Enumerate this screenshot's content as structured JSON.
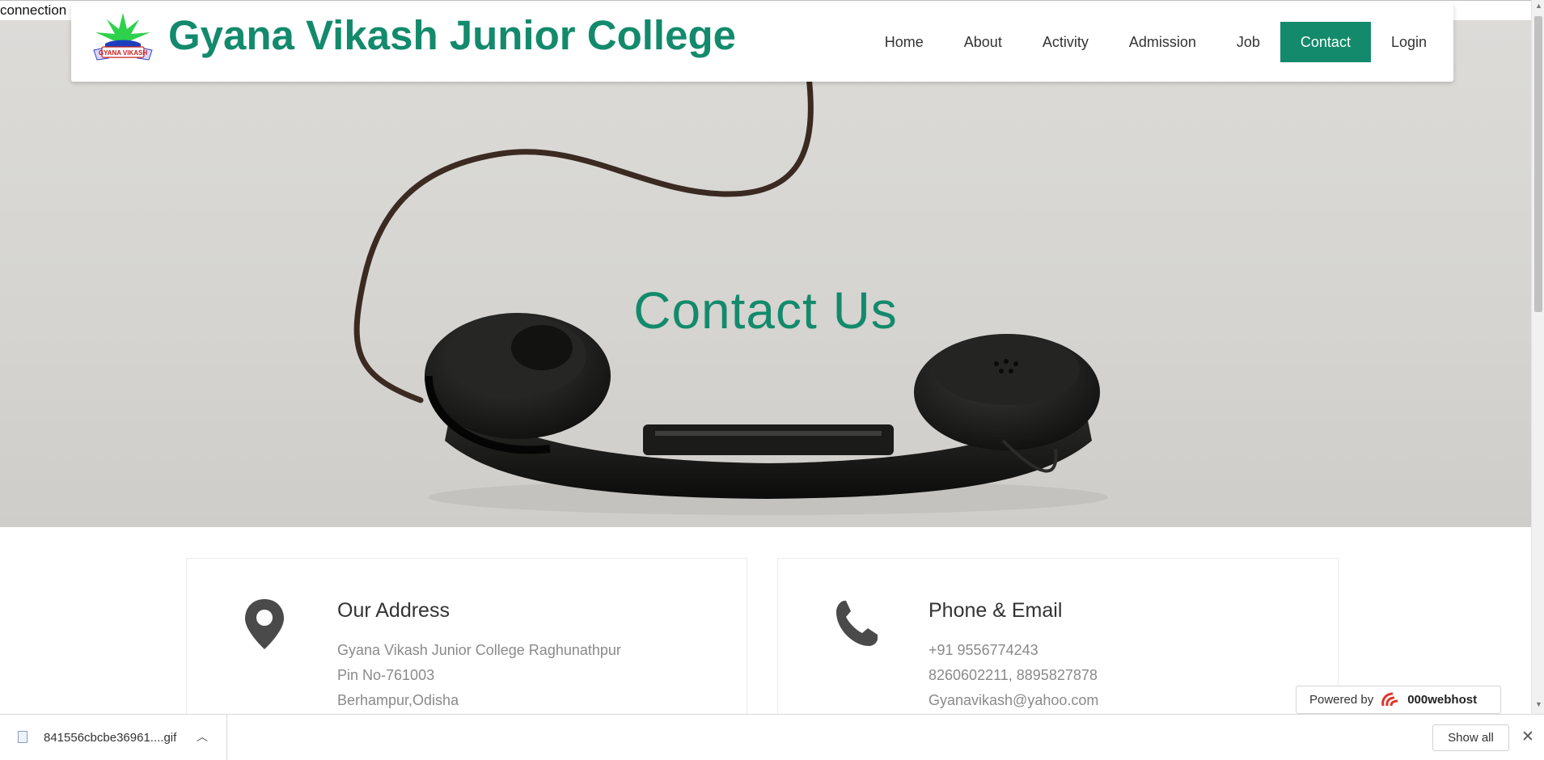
{
  "status_fragment": "connection",
  "header": {
    "title": "Gyana Vikash Junior College",
    "logo_text": "GYANA VIKASH",
    "nav": [
      {
        "label": "Home",
        "active": false
      },
      {
        "label": "About",
        "active": false
      },
      {
        "label": "Activity",
        "active": false
      },
      {
        "label": "Admission",
        "active": false
      },
      {
        "label": "Job",
        "active": false
      },
      {
        "label": "Contact",
        "active": true
      },
      {
        "label": "Login",
        "active": false
      }
    ]
  },
  "hero": {
    "title": "Contact Us"
  },
  "address_card": {
    "icon": "map-marker-icon",
    "heading": "Our Address",
    "lines": [
      "Gyana Vikash Junior College Raghunathpur",
      "Pin No-761003",
      "Berhampur,Odisha"
    ]
  },
  "phone_card": {
    "icon": "phone-icon",
    "heading": "Phone & Email",
    "lines": [
      "+91 9556774243",
      "8260602211, 8895827878",
      "Gyanavikash@yahoo.com"
    ]
  },
  "powered": {
    "prefix": "Powered by",
    "brand": "000webhost"
  },
  "download_bar": {
    "file_name": "841556cbcbe36961....gif",
    "show_all": "Show all"
  },
  "colors": {
    "brand": "#138a6c",
    "text": "#333333",
    "muted": "#8a8a8a"
  }
}
